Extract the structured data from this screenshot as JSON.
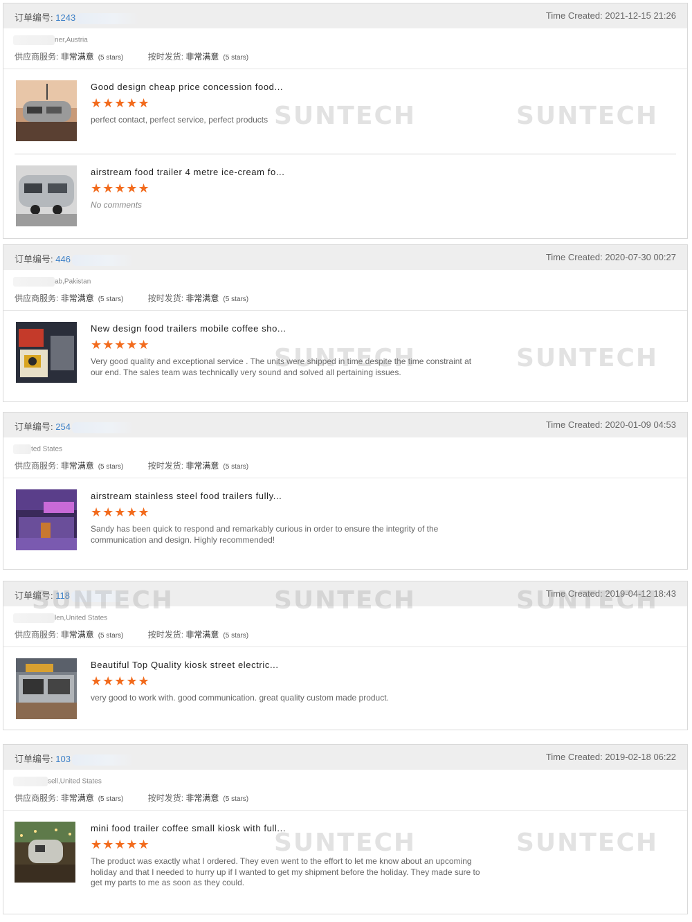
{
  "labels": {
    "order_no": "订单编号:",
    "time_created": "Time Created:",
    "supplier_service": "供应商服务:",
    "on_time_delivery": "按时发货:",
    "rating_value": "非常满意",
    "rating_stars": "(5 stars)",
    "star_glyphs": "★★★★★"
  },
  "watermark_text": "SUNTECH",
  "orders": [
    {
      "order_number": "1243",
      "time": "2021-12-15 21:26",
      "location": "ner,Austria",
      "products": [
        {
          "title": "Good design cheap price concession food...",
          "comment": "perfect contact, perfect service, perfect products",
          "no_comment": false
        },
        {
          "title": "airstream food trailer 4 metre ice-cream fo...",
          "comment": "No comments",
          "no_comment": true
        }
      ]
    },
    {
      "order_number": "446",
      "time": "2020-07-30 00:27",
      "location": "ab,Pakistan",
      "products": [
        {
          "title": "New design food trailers mobile coffee sho...",
          "comment": "Very good quality and exceptional service . The units were shipped in time despite the time constraint at our end. The sales team was technically very sound and solved all pertaining issues.",
          "no_comment": false
        }
      ]
    },
    {
      "order_number": "254",
      "time": "2020-01-09 04:53",
      "location": "ted States",
      "products": [
        {
          "title": "airstream stainless steel food trailers fully...",
          "comment": "Sandy has been quick to respond and remarkably curious in order to ensure the integrity of the communication and design.  Highly recommended!",
          "no_comment": false
        }
      ]
    },
    {
      "order_number": "118",
      "time": "2019-04-12 18:43",
      "location": "len,United States",
      "products": [
        {
          "title": "Beautiful Top Quality kiosk street electric...",
          "comment": "very good to work with. good communication. great quality custom made product.",
          "no_comment": false
        }
      ]
    },
    {
      "order_number": "103",
      "time": "2019-02-18 06:22",
      "location": "sell,United States",
      "products": [
        {
          "title": "mini food trailer coffee small kiosk with full...",
          "comment": "The product was exactly what I ordered. They even went to the effort to let me know about an upcoming holiday and that I needed to hurry up if I wanted to get my shipment before the holiday. They made sure to get my parts to me as soon as they could.",
          "no_comment": false
        }
      ]
    }
  ]
}
